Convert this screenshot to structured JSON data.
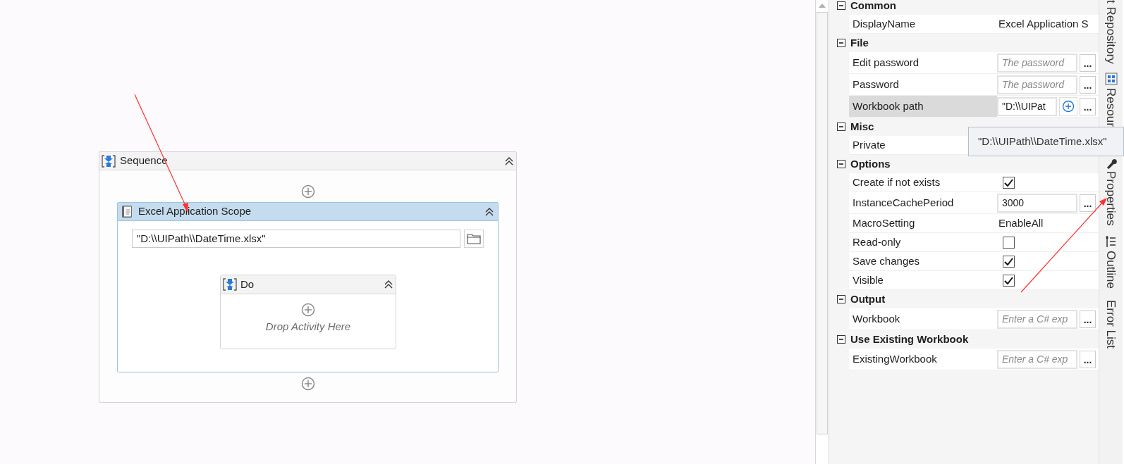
{
  "designer": {
    "sequence": {
      "title": "Sequence",
      "selected": false,
      "scope": {
        "title": "Excel Application Scope",
        "selected": true,
        "path": "\"D:\\\\UIPath\\\\DateTime.xlsx\"",
        "body": {
          "title": "Do",
          "selected": false,
          "hint": "Drop Activity Here"
        }
      }
    }
  },
  "properties": {
    "categories": [
      {
        "name": "Common",
        "expanded": true,
        "items": [
          {
            "kind": "text",
            "name": "DisplayName",
            "value": "Excel Application S",
            "selected": false
          }
        ]
      },
      {
        "name": "File",
        "expanded": true,
        "items": [
          {
            "kind": "field",
            "name": "Edit password",
            "placeholder": "The password",
            "button": "...",
            "selected": false
          },
          {
            "kind": "field",
            "name": "Password",
            "placeholder": "The password",
            "button": "...",
            "selected": false
          },
          {
            "kind": "expression",
            "name": "Workbook path",
            "value": "\"D:\\\\UIPat",
            "button": "...",
            "selected": true
          }
        ]
      },
      {
        "name": "Misc",
        "expanded": true,
        "items": [
          {
            "kind": "text",
            "name": "Private",
            "selected": false
          }
        ]
      },
      {
        "name": "Options",
        "expanded": true,
        "items": [
          {
            "kind": "checkbox",
            "name": "Create if not exists",
            "checked": true,
            "selected": false
          },
          {
            "kind": "field",
            "name": "InstanceCachePeriod",
            "value": "3000",
            "button": "...",
            "selected": false
          },
          {
            "kind": "text",
            "name": "MacroSetting",
            "value": "EnableAll",
            "selected": false
          },
          {
            "kind": "checkbox",
            "name": "Read-only",
            "checked": false,
            "selected": false
          },
          {
            "kind": "checkbox",
            "name": "Save changes",
            "checked": true,
            "selected": false
          },
          {
            "kind": "checkbox",
            "name": "Visible",
            "checked": true,
            "selected": false
          }
        ]
      },
      {
        "name": "Output",
        "expanded": true,
        "items": [
          {
            "kind": "field",
            "name": "Workbook",
            "placeholder": "Enter a C# exp",
            "button": "...",
            "selected": false
          }
        ]
      },
      {
        "name": "Use Existing Workbook",
        "expanded": true,
        "items": [
          {
            "kind": "field",
            "name": "ExistingWorkbook",
            "placeholder": "Enter a C# exp",
            "button": "...",
            "selected": false
          }
        ]
      }
    ]
  },
  "tooltip": "\"D:\\\\UIPath\\\\DateTime.xlsx\"",
  "side_tabs": [
    {
      "kind": "text",
      "label": "t Repository"
    },
    {
      "kind": "resources",
      "label": "Resour"
    },
    {
      "kind": "properties",
      "label": "Properties"
    },
    {
      "kind": "outline",
      "label": "Outline"
    },
    {
      "kind": "text",
      "label": "Error List"
    }
  ]
}
